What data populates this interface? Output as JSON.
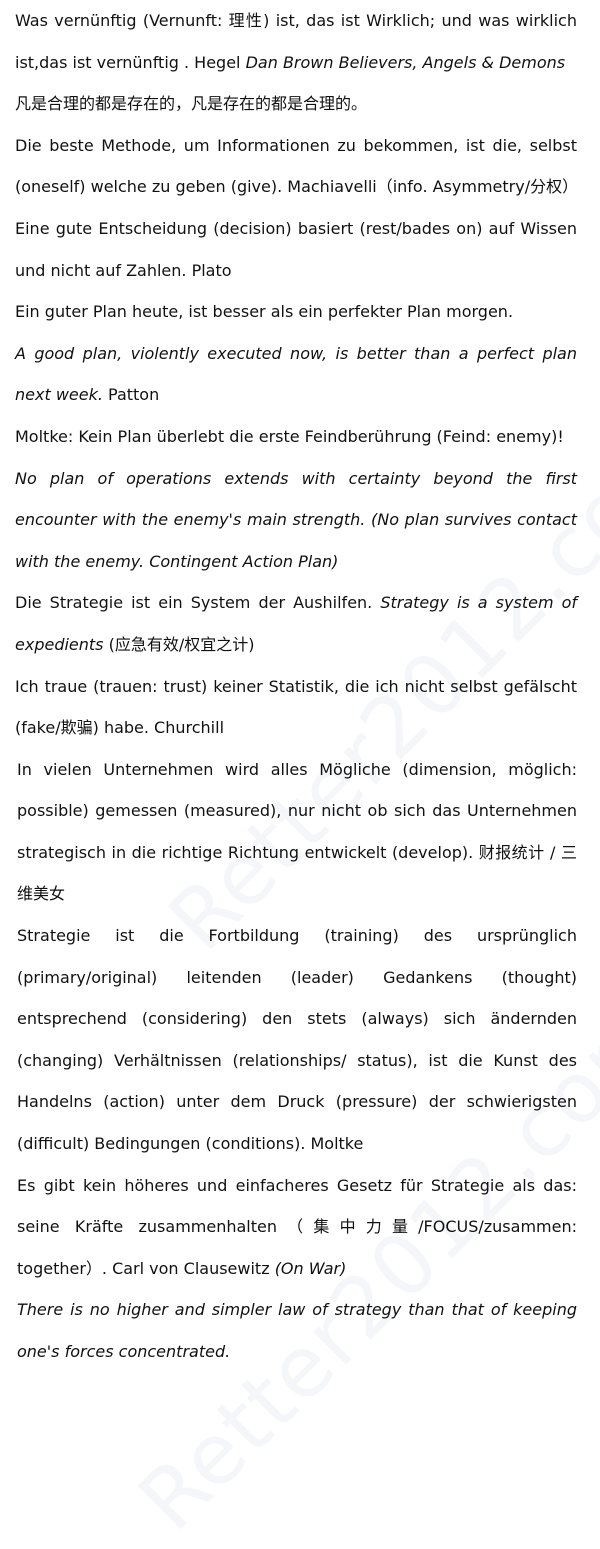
{
  "watermark": "Retter2012.com",
  "paragraphs": [
    [
      {
        "t": "Was vernünftig (Vernunft: 理性) ist, das ist Wirklich; und was wirklich ist,das ist vernünftig . Hegel"
      },
      {
        "t": "    "
      },
      {
        "t": "Dan Brown Believers, Angels & Demons",
        "i": true
      }
    ],
    [
      {
        "t": "凡是合理的都是存在的，凡是存在的都是合理的。"
      }
    ],
    [
      {
        "t": "Die beste Methode, um Informationen zu bekommen, ist die, selbst (oneself) welche zu geben (give). Machiavelli（info. Asymmetry/分权）"
      }
    ],
    [
      {
        "t": "Eine gute Entscheidung (decision) basiert (rest/bades on) auf Wissen und nicht auf Zahlen. Plato"
      }
    ],
    [
      {
        "t": "Ein guter Plan heute, ist besser als ein perfekter Plan morgen."
      }
    ],
    [
      {
        "t": "A good plan, violently executed now, is better than a perfect plan next week.",
        "i": true
      },
      {
        "t": " Patton"
      }
    ],
    [
      {
        "t": "Moltke: Kein Plan überlebt die erste Feindberührung (Feind: enemy)!"
      }
    ],
    [
      {
        "t": "No plan of operations extends with certainty beyond the first encounter with the enemy's main strength. (No plan survives contact with the enemy. Contingent Action Plan)",
        "i": true
      }
    ],
    [
      {
        "t": "Die Strategie ist ein System der Aushilfen. "
      },
      {
        "t": "Strategy is a system of expedients",
        "i": true
      },
      {
        "t": " (应急有效/权宜之计)"
      }
    ],
    [
      {
        "t": "Ich traue (trauen: trust) keiner Statistik, die ich nicht selbst gefälscht (fake/欺骗) habe.    Churchill"
      }
    ],
    [
      {
        "t": "In vielen Unternehmen wird alles Mögliche (dimension, möglich: possible) gemessen (measured), nur nicht ob sich das Unternehmen strategisch in die richtige Richtung entwickelt (develop). 财报统计 / 三维美女"
      }
    ],
    [
      {
        "t": "Strategie ist die Fortbildung (training) des ursprünglich (primary/original) leitenden (leader) Gedankens (thought) entsprechend (considering) den stets (always) sich ändernden (changing) Verhältnissen (relationships/ status), ist die Kunst des Handelns (action) unter dem Druck (pressure) der schwierigsten (difficult) Bedingungen (conditions).    Moltke"
      }
    ],
    [
      {
        "t": "Es gibt kein höheres und einfacheres Gesetz für Strategie als das: seine Kräfte zusammenhalten（集中力量/FOCUS/zusammen: together）. Carl von Clausewitz "
      },
      {
        "t": "(On War)",
        "i": true
      }
    ],
    [
      {
        "t": "There is no higher and simpler law of strategy than that of keeping one's forces concentrated.",
        "i": true
      }
    ]
  ]
}
